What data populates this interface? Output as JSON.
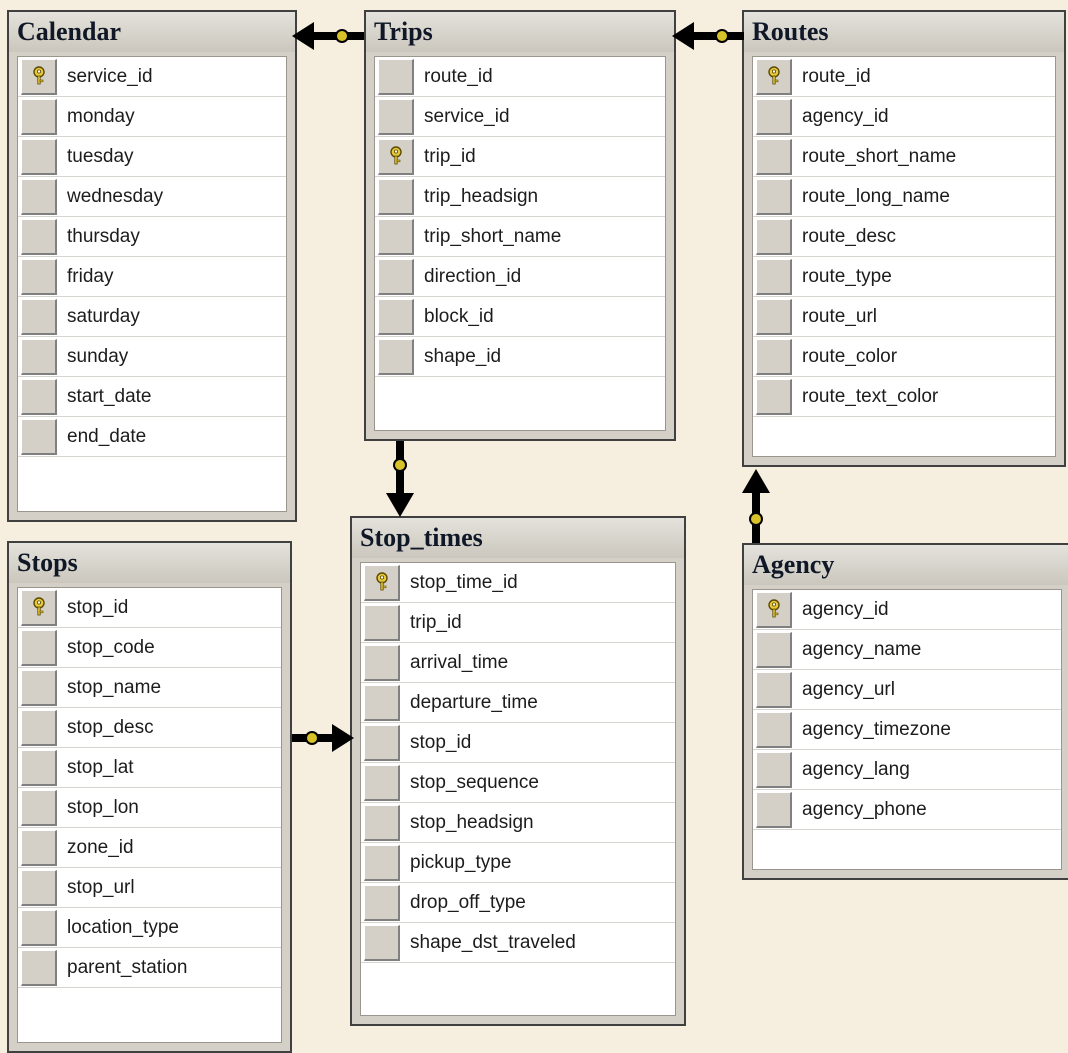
{
  "tables": [
    {
      "id": "calendar",
      "title": "Calendar",
      "columns": [
        {
          "name": "service_id",
          "pk": true
        },
        {
          "name": "monday"
        },
        {
          "name": "tuesday"
        },
        {
          "name": "wednesday"
        },
        {
          "name": "thursday"
        },
        {
          "name": "friday"
        },
        {
          "name": "saturday"
        },
        {
          "name": "sunday"
        },
        {
          "name": "start_date"
        },
        {
          "name": "end_date"
        }
      ]
    },
    {
      "id": "trips",
      "title": "Trips",
      "columns": [
        {
          "name": "route_id"
        },
        {
          "name": "service_id"
        },
        {
          "name": "trip_id",
          "pk": true
        },
        {
          "name": "trip_headsign"
        },
        {
          "name": "trip_short_name"
        },
        {
          "name": "direction_id"
        },
        {
          "name": "block_id"
        },
        {
          "name": "shape_id"
        }
      ]
    },
    {
      "id": "routes",
      "title": "Routes",
      "columns": [
        {
          "name": "route_id",
          "pk": true
        },
        {
          "name": "agency_id"
        },
        {
          "name": "route_short_name"
        },
        {
          "name": "route_long_name"
        },
        {
          "name": "route_desc"
        },
        {
          "name": "route_type"
        },
        {
          "name": "route_url"
        },
        {
          "name": "route_color"
        },
        {
          "name": "route_text_color"
        }
      ]
    },
    {
      "id": "stops",
      "title": "Stops",
      "columns": [
        {
          "name": "stop_id",
          "pk": true
        },
        {
          "name": "stop_code"
        },
        {
          "name": "stop_name"
        },
        {
          "name": "stop_desc"
        },
        {
          "name": "stop_lat"
        },
        {
          "name": "stop_lon"
        },
        {
          "name": "zone_id"
        },
        {
          "name": "stop_url"
        },
        {
          "name": "location_type"
        },
        {
          "name": "parent_station"
        }
      ]
    },
    {
      "id": "stop_times",
      "title": "Stop_times",
      "columns": [
        {
          "name": "stop_time_id",
          "pk": true
        },
        {
          "name": "trip_id"
        },
        {
          "name": "arrival_time"
        },
        {
          "name": "departure_time"
        },
        {
          "name": "stop_id"
        },
        {
          "name": "stop_sequence"
        },
        {
          "name": "stop_headsign"
        },
        {
          "name": "pickup_type"
        },
        {
          "name": "drop_off_type"
        },
        {
          "name": "shape_dst_traveled"
        }
      ]
    },
    {
      "id": "agency",
      "title": "Agency",
      "columns": [
        {
          "name": "agency_id",
          "pk": true
        },
        {
          "name": "agency_name"
        },
        {
          "name": "agency_url"
        },
        {
          "name": "agency_timezone"
        },
        {
          "name": "agency_lang"
        },
        {
          "name": "agency_phone"
        }
      ]
    }
  ],
  "relationships": [
    {
      "from": "trips",
      "to": "calendar"
    },
    {
      "from": "routes",
      "to": "trips"
    },
    {
      "from": "trips",
      "to": "stop_times"
    },
    {
      "from": "agency",
      "to": "routes"
    },
    {
      "from": "stops",
      "to": "stop_times"
    }
  ],
  "colors": {
    "background": "#f6efe0",
    "window": "#d4d0c8",
    "arrow": "#000000",
    "key": "#e8c93a"
  }
}
